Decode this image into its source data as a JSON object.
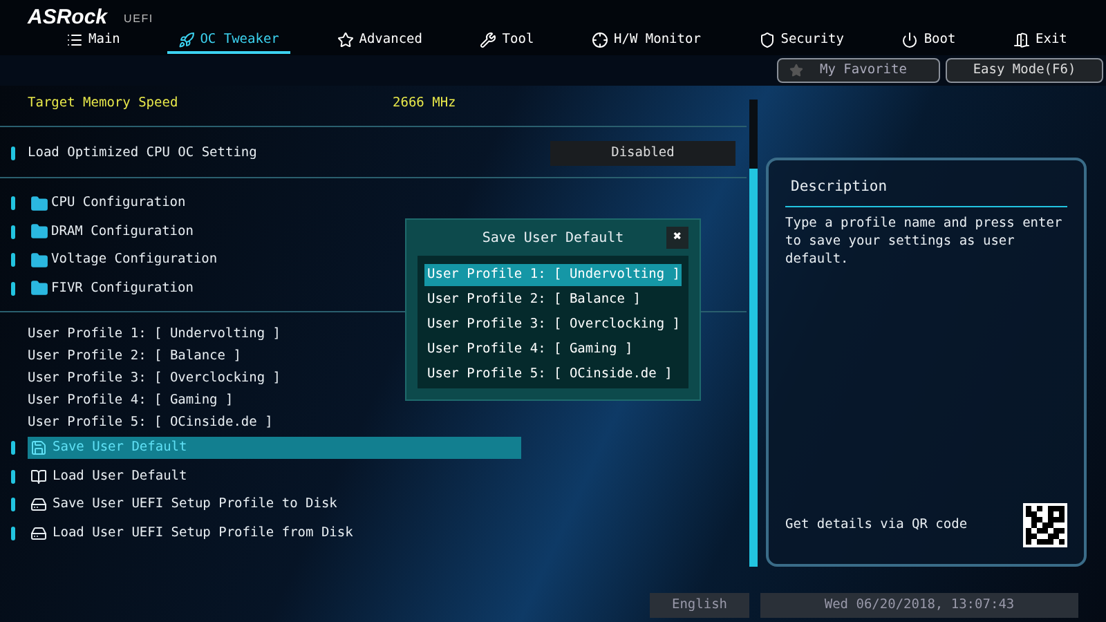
{
  "logo": {
    "brand": "ASRock",
    "sub": "UEFI"
  },
  "tabs": [
    {
      "label": "Main",
      "selected": false
    },
    {
      "label": "OC Tweaker",
      "selected": true
    },
    {
      "label": "Advanced",
      "selected": false
    },
    {
      "label": "Tool",
      "selected": false
    },
    {
      "label": "H/W Monitor",
      "selected": false
    },
    {
      "label": "Security",
      "selected": false
    },
    {
      "label": "Boot",
      "selected": false
    },
    {
      "label": "Exit",
      "selected": false
    }
  ],
  "favorite": "My Favorite",
  "easy_mode": "Easy Mode(F6)",
  "groups": [
    [
      {
        "kind": "info",
        "label": "Target Memory Speed",
        "value": "2666 MHz"
      }
    ],
    [
      {
        "kind": "setting",
        "label": "Load Optimized CPU OC Setting",
        "value": "Disabled"
      }
    ],
    [
      {
        "kind": "folder",
        "label": "CPU Configuration"
      },
      {
        "kind": "folder",
        "label": "DRAM Configuration"
      },
      {
        "kind": "folder",
        "label": "Voltage Configuration"
      },
      {
        "kind": "folder",
        "label": "FIVR Configuration"
      }
    ],
    [
      {
        "kind": "text",
        "label": "User Profile 1: [ Undervolting ]"
      },
      {
        "kind": "text",
        "label": "User Profile 2: [ Balance ]"
      },
      {
        "kind": "text",
        "label": "User Profile 3: [ Overclocking ]"
      },
      {
        "kind": "text",
        "label": "User Profile 4: [ Gaming ]"
      },
      {
        "kind": "text",
        "label": "User Profile 5: [ OCinside.de ]"
      },
      {
        "kind": "save",
        "label": "Save User Default",
        "selected": true
      },
      {
        "kind": "load",
        "label": "Load User Default",
        "selected": false
      },
      {
        "kind": "disk",
        "label": "Save User UEFI Setup Profile to Disk",
        "selected": false
      },
      {
        "kind": "disk",
        "label": "Load User UEFI Setup Profile from Disk",
        "selected": false
      }
    ]
  ],
  "description": {
    "title": "Description",
    "text": "Type a profile name and press enter to save your settings as user default.",
    "qr_hint": "Get details via QR code"
  },
  "dialog": {
    "title": "Save User Default",
    "close": "✖",
    "options": [
      {
        "label": "User Profile 1: [ Undervolting ]",
        "selected": true
      },
      {
        "label": "User Profile 2: [ Balance ]",
        "selected": false
      },
      {
        "label": "User Profile 3: [ Overclocking ]",
        "selected": false
      },
      {
        "label": "User Profile 4: [ Gaming ]",
        "selected": false
      },
      {
        "label": "User Profile 5: [ OCinside.de ]",
        "selected": false
      }
    ]
  },
  "status": {
    "language": "English",
    "datetime": "Wed 06/20/2018, 13:07:43"
  }
}
